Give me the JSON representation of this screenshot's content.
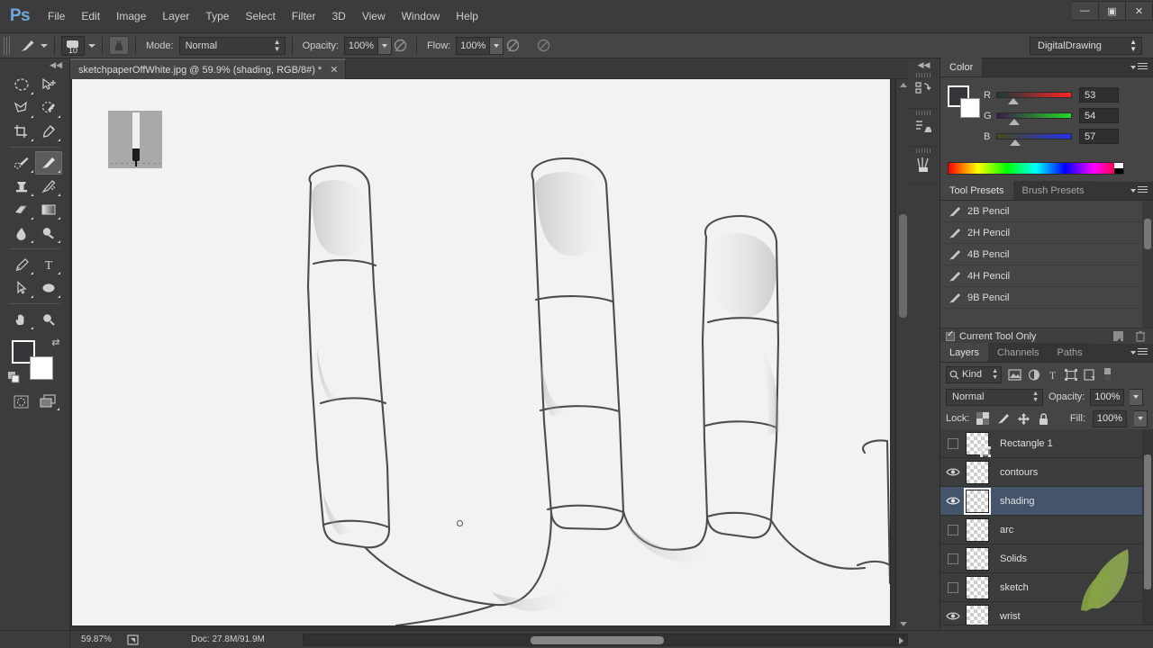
{
  "app": {
    "logo": "Ps",
    "menus": [
      "File",
      "Edit",
      "Image",
      "Layer",
      "Type",
      "Select",
      "Filter",
      "3D",
      "View",
      "Window",
      "Help"
    ],
    "window_controls": {
      "minimize": "—",
      "maximize": "▣",
      "close": "✕"
    }
  },
  "options_bar": {
    "brush_size": "10",
    "mode_label": "Mode:",
    "mode_value": "Normal",
    "opacity_label": "Opacity:",
    "opacity_value": "100%",
    "flow_label": "Flow:",
    "flow_value": "100%",
    "workspace": "DigitalDrawing"
  },
  "document": {
    "tab_title": "sketchpaperOffWhite.jpg @ 59.9% (shading, RGB/8#) *",
    "close_glyph": "✕"
  },
  "toolbar": {
    "tools": [
      {
        "name": "marquee-tool",
        "glyph": "marquee"
      },
      {
        "name": "move-tool",
        "glyph": "move"
      },
      {
        "name": "lasso-tool",
        "glyph": "lasso"
      },
      {
        "name": "quick-selection-tool",
        "glyph": "quickselect"
      },
      {
        "name": "crop-tool",
        "glyph": "crop"
      },
      {
        "name": "eyedropper-tool",
        "glyph": "eyedropper"
      },
      {
        "name": "healing-brush-tool",
        "glyph": "heal"
      },
      {
        "name": "brush-tool",
        "glyph": "brush",
        "selected": true
      },
      {
        "name": "clone-stamp-tool",
        "glyph": "stamp"
      },
      {
        "name": "history-brush-tool",
        "glyph": "historybrush"
      },
      {
        "name": "eraser-tool",
        "glyph": "eraser"
      },
      {
        "name": "gradient-tool",
        "glyph": "gradient"
      },
      {
        "name": "blur-tool",
        "glyph": "blur"
      },
      {
        "name": "dodge-tool",
        "glyph": "dodge"
      },
      {
        "name": "pen-tool",
        "glyph": "pen"
      },
      {
        "name": "type-tool",
        "glyph": "T"
      },
      {
        "name": "path-selection-tool",
        "glyph": "arrow"
      },
      {
        "name": "ellipse-tool",
        "glyph": "ellipse"
      },
      {
        "name": "hand-tool",
        "glyph": "hand"
      },
      {
        "name": "zoom-tool",
        "glyph": "zoom"
      }
    ],
    "foreground_color": "#353639",
    "background_color": "#ffffff"
  },
  "panels": {
    "color": {
      "tab": "Color",
      "channels": [
        {
          "label": "R",
          "value": "53"
        },
        {
          "label": "G",
          "value": "54"
        },
        {
          "label": "B",
          "value": "57"
        }
      ]
    },
    "presets": {
      "tabs": [
        "Tool Presets",
        "Brush Presets"
      ],
      "active_tab": "Tool Presets",
      "items": [
        "2B Pencil",
        "2H Pencil",
        "4B Pencil",
        "4H Pencil",
        "9B Pencil"
      ],
      "footer_checkbox": "Current Tool Only"
    },
    "layers": {
      "tabs": [
        "Layers",
        "Channels",
        "Paths"
      ],
      "active_tab": "Layers",
      "filter_kind": "Kind",
      "blend_mode": "Normal",
      "opacity_label": "Opacity:",
      "opacity_value": "100%",
      "lock_label": "Lock:",
      "fill_label": "Fill:",
      "fill_value": "100%",
      "rows": [
        {
          "name": "Rectangle 1",
          "visible": false,
          "selected": false
        },
        {
          "name": "contours",
          "visible": true,
          "selected": false
        },
        {
          "name": "shading",
          "visible": true,
          "selected": true
        },
        {
          "name": "arc",
          "visible": false,
          "selected": false
        },
        {
          "name": "Solids",
          "visible": false,
          "selected": false
        },
        {
          "name": "sketch",
          "visible": false,
          "selected": false
        },
        {
          "name": "wrist",
          "visible": true,
          "selected": false
        }
      ]
    }
  },
  "status_bar": {
    "zoom": "59.87%",
    "doc_info": "Doc: 27.8M/91.9M"
  },
  "dock_strip": {
    "buttons": [
      "history-icon",
      "actions-icon",
      "brush-icon"
    ]
  }
}
